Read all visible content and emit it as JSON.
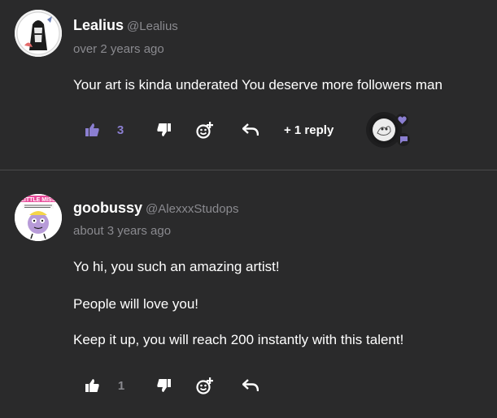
{
  "colors": {
    "background": "#2a2a2b",
    "muted_text": "#8a8a8f",
    "accent_purple": "#8b7fd1",
    "divider": "#4a4a4c"
  },
  "comments": [
    {
      "username": "Lealius",
      "handle": "@Lealius",
      "timestamp": "over 2 years ago",
      "body": [
        "Your art is kinda underated You deserve more followers man"
      ],
      "likes": "3",
      "liked": true,
      "reply_label": "+ 1 reply",
      "icons": [
        "thumbs-up-icon",
        "thumbs-down-icon",
        "add-reaction-icon",
        "reply-arrow-icon",
        "heart-icon",
        "chat-bubble-icon"
      ]
    },
    {
      "username": "goobussy",
      "handle": "@AlexxxStudops",
      "timestamp": "about 3 years ago",
      "avatar_text": "LITTLE MISS",
      "body": [
        "Yo hi, you such an amazing artist!",
        "People will love you!",
        "Keep it up, you will reach 200 instantly with this talent!"
      ],
      "likes": "1",
      "liked": false,
      "icons": [
        "thumbs-up-icon",
        "thumbs-down-icon",
        "add-reaction-icon",
        "reply-arrow-icon"
      ]
    }
  ]
}
